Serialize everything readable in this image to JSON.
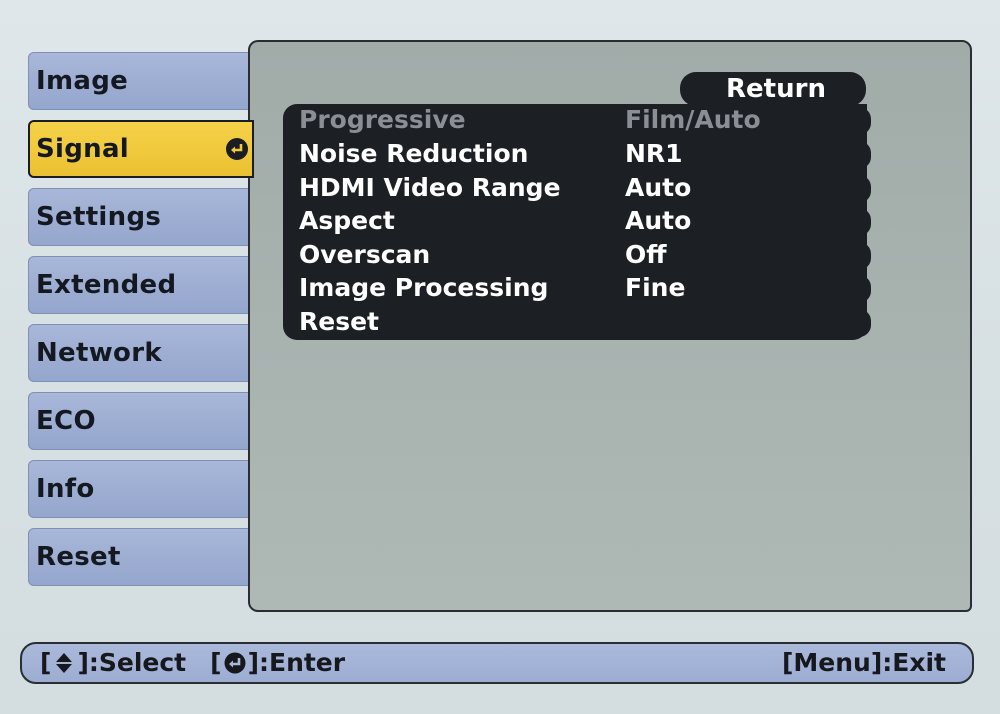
{
  "menu": {
    "items": [
      {
        "label": "Image"
      },
      {
        "label": "Signal",
        "selected": true
      },
      {
        "label": "Settings"
      },
      {
        "label": "Extended"
      },
      {
        "label": "Network"
      },
      {
        "label": "ECO"
      },
      {
        "label": "Info"
      },
      {
        "label": "Reset"
      }
    ]
  },
  "panel": {
    "return_label": "Return",
    "rows": [
      {
        "label": "Progressive",
        "value": "Film/Auto",
        "disabled": true
      },
      {
        "label": "Noise Reduction",
        "value": "NR1"
      },
      {
        "label": "HDMI Video Range",
        "value": "Auto"
      },
      {
        "label": "Aspect",
        "value": "Auto"
      },
      {
        "label": "Overscan",
        "value": "Off"
      },
      {
        "label": "Image Processing",
        "value": "Fine"
      },
      {
        "label": "Reset",
        "value": ""
      }
    ]
  },
  "status": {
    "select_open": "[",
    "select_close": "]:Select",
    "enter_open": "[",
    "enter_close": "]:Enter",
    "exit": "[Menu]:Exit"
  },
  "icons": {
    "enter": "enter-icon",
    "updown": "updown-arrow-icon"
  },
  "colors": {
    "selected_tab": "#f0c93c",
    "tab": "#9dadd2",
    "list_bg": "#1c1f24",
    "panel_bg": "#a9b3b0"
  }
}
